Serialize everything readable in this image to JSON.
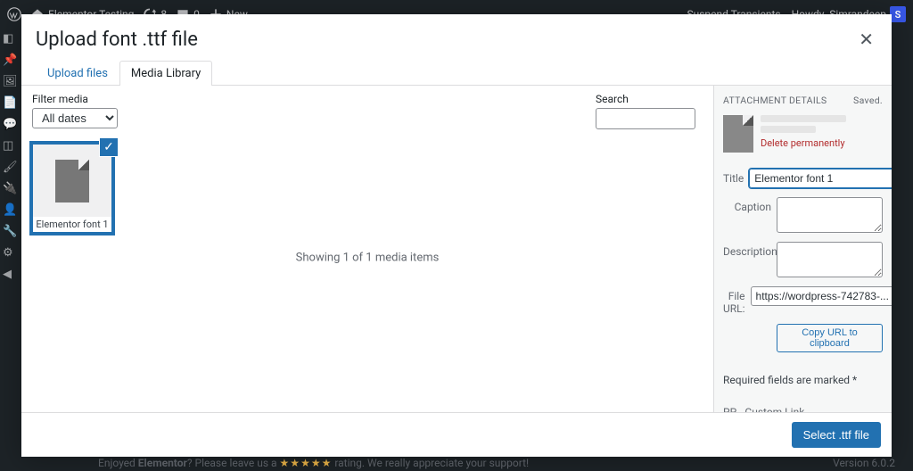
{
  "admin_bar": {
    "site_name": "Elementor Testing",
    "updates_count": "8",
    "comments_count": "0",
    "new_label": "New",
    "suspend_transients": "Suspend Transients",
    "howdy_prefix": "Howdy, ",
    "user_name": "Simrandeep",
    "user_initial": "S"
  },
  "modal": {
    "title": "Upload font .ttf file",
    "close_symbol": "✕",
    "tabs": {
      "upload": "Upload files",
      "library": "Media Library"
    },
    "toolbar": {
      "filter_label": "Filter media",
      "date_option": "All dates",
      "search_label": "Search"
    },
    "grid": {
      "status_text": "Showing 1 of 1 media items",
      "items": [
        {
          "name": "Elementor font 1",
          "selected": true
        }
      ]
    },
    "details": {
      "heading": "ATTACHMENT DETAILS",
      "saved_label": "Saved.",
      "delete_label": "Delete permanently",
      "fields": {
        "title_label": "Title",
        "title_value": "Elementor font 1",
        "caption_label": "Caption",
        "caption_value": "",
        "description_label": "Description",
        "description_value": "",
        "fileurl_label": "File URL:",
        "fileurl_value": "https://wordpress-742783-...",
        "copy_label": "Copy URL to clipboard",
        "required_note": "Required fields are marked *",
        "pp_custom_label": "PP - Custom Link",
        "pp_custom_value": ""
      }
    },
    "footer": {
      "select_label": "Select .ttf file"
    }
  },
  "page_footer": {
    "enjoyed_prefix": "Enjoyed ",
    "elementor": "Elementor",
    "leave_text": "? Please leave us a ",
    "stars": "★★★★★",
    "rating_text": " rating. We really appreciate your support!",
    "version": "Version 6.0.2"
  }
}
